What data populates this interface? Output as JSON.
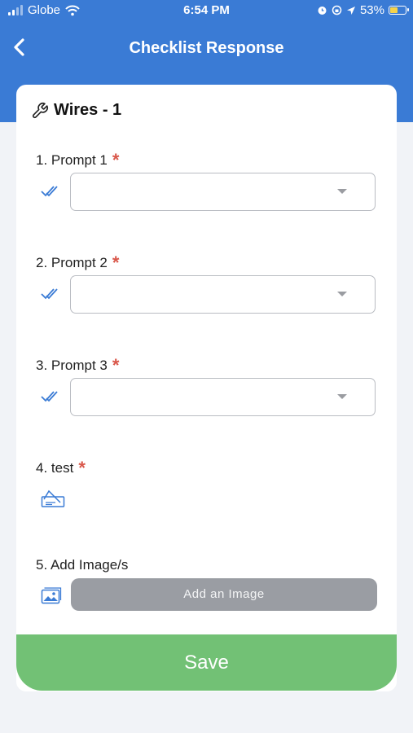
{
  "status": {
    "carrier": "Globe",
    "time": "6:54 PM",
    "battery": "53%",
    "battery_level": 0.53
  },
  "nav": {
    "title": "Checklist Response"
  },
  "card": {
    "title": "Wires - 1"
  },
  "questions": [
    {
      "label": "1. Prompt 1",
      "required": true,
      "type": "dropdown",
      "value": ""
    },
    {
      "label": "2. Prompt 2",
      "required": true,
      "type": "dropdown",
      "value": ""
    },
    {
      "label": "3. Prompt 3",
      "required": true,
      "type": "dropdown",
      "value": ""
    },
    {
      "label": "4. test",
      "required": true,
      "type": "signature"
    },
    {
      "label": "5. Add Image/s",
      "required": false,
      "type": "image"
    }
  ],
  "add_image_label": "Add an Image",
  "save_label": "Save",
  "colors": {
    "header": "#3a7bd5",
    "asterisk": "#d9574a",
    "save": "#72c175",
    "add_image": "#9a9da3",
    "icon": "#3a7bd5"
  }
}
